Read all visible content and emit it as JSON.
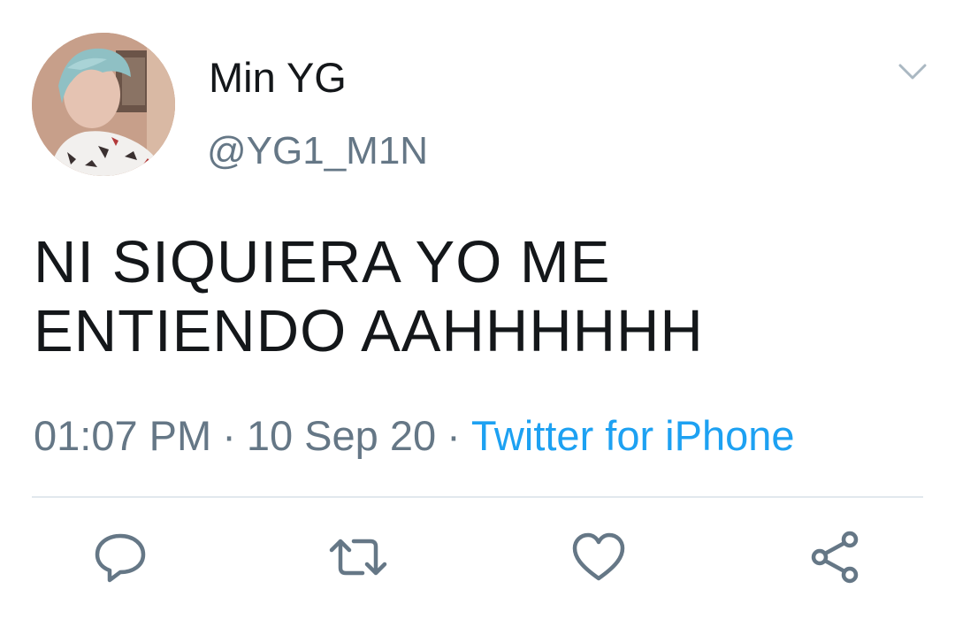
{
  "user": {
    "display_name": "Min YG",
    "handle": "@YG1_M1N"
  },
  "tweet": {
    "lines": [
      "NI SIQUIERA YO ME",
      "ENTIENDO AAHHHHHH"
    ],
    "time": "01:07 PM",
    "date": "10 Sep 20",
    "separator": "·",
    "source": "Twitter for iPhone"
  },
  "icons": {
    "menu": "chevron-down-icon",
    "reply": "reply-icon",
    "retweet": "retweet-icon",
    "like": "heart-icon",
    "share": "share-icon"
  },
  "colors": {
    "text": "#14171a",
    "secondary": "#657786",
    "link": "#1da1f2",
    "icon": "#657786",
    "divider": "#e1e8ed"
  }
}
